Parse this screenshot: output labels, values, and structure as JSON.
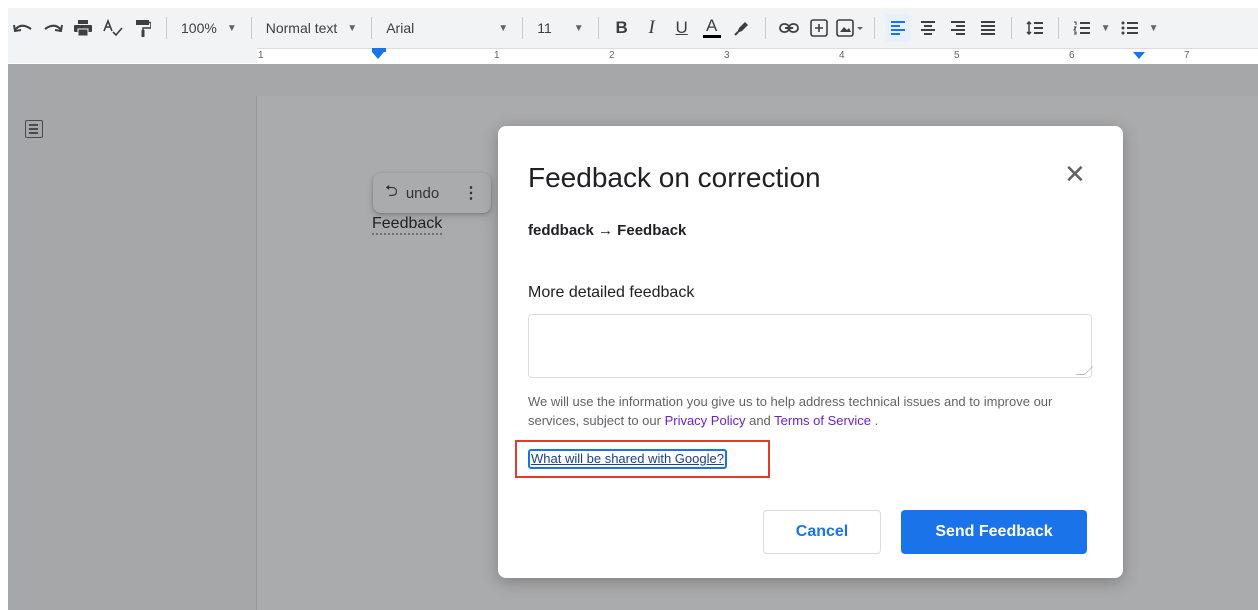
{
  "toolbar": {
    "zoom": "100%",
    "style": "Normal text",
    "font": "Arial",
    "font_size": "11",
    "bold": "B",
    "italic": "I",
    "underline": "U",
    "text_color": "A"
  },
  "ruler": {
    "numbers": [
      "1",
      "1",
      "2",
      "3",
      "4",
      "5",
      "6",
      "7"
    ]
  },
  "document": {
    "word": "Feedback"
  },
  "undo_popup": {
    "icon": "undo-arrow-icon",
    "label": "undo"
  },
  "dialog": {
    "title": "Feedback on correction",
    "correction": "feddback → Feedback",
    "detail_label": "More detailed feedback",
    "detail_value": "",
    "disclaimer_pre": "We will use the information you give us to help address technical issues and to improve our services, subject to our ",
    "privacy_link": "Privacy Policy",
    "disclaimer_and": " and ",
    "terms_link": "Terms of Service",
    "disclaimer_post": " .",
    "shared_link": "What will be shared with Google?",
    "cancel_label": "Cancel",
    "send_label": "Send Feedback"
  },
  "colors": {
    "accent": "#1a73e8",
    "highlight": "#e43a2e",
    "link_purple": "#6a1fd1"
  }
}
